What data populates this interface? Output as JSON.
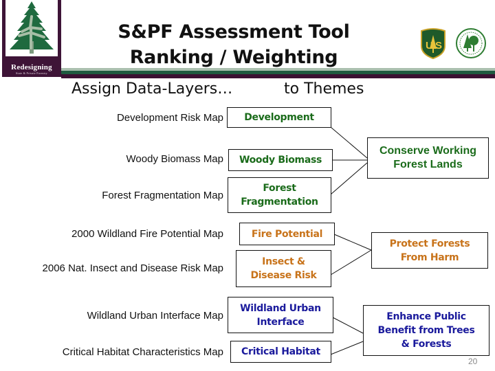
{
  "header": {
    "logo": {
      "icon": "evergreen-tree-icon",
      "title": "Redesigning",
      "subtitle": "State & Private Forestry"
    },
    "title_line1": "S&PF Assessment Tool",
    "title_line2": "Ranking / Weighting",
    "agency_logos": [
      "usda-forest-service-shield-icon",
      "state-foresters-seal-icon"
    ]
  },
  "subtitle": {
    "left": "Assign Data-Layers…",
    "right": "to Themes"
  },
  "map_labels": [
    "Development Risk Map",
    "Woody Biomass Map",
    "Forest Fragmentation Map",
    "2000 Wildland Fire Potential Map",
    "2006 Nat. Insect and Disease Risk Map",
    "Wildland Urban Interface Map",
    "Critical Habitat Characteristics Map"
  ],
  "data_layers": [
    {
      "line1": "Development",
      "line2": "",
      "theme": 0
    },
    {
      "line1": "Woody Biomass",
      "line2": "",
      "theme": 0
    },
    {
      "line1": "Forest",
      "line2": "Fragmentation",
      "theme": 0
    },
    {
      "line1": "Fire Potential",
      "line2": "",
      "theme": 1
    },
    {
      "line1": "Insect &",
      "line2": "Disease Risk",
      "theme": 1
    },
    {
      "line1": "Wildland Urban",
      "line2": "Interface",
      "theme": 2
    },
    {
      "line1": "Critical Habitat",
      "line2": "",
      "theme": 2
    }
  ],
  "themes": [
    {
      "line1": "Conserve Working",
      "line2": "Forest Lands",
      "line3": "",
      "color": "#1a6b1a"
    },
    {
      "line1": "Protect Forests",
      "line2": "From Harm",
      "line3": "",
      "color": "#c8731a"
    },
    {
      "line1": "Enhance Public",
      "line2": "Benefit from Trees",
      "line3": "& Forests",
      "color": "#1a1a9c"
    }
  ],
  "colors": {
    "green": "#1a6b1a",
    "orange": "#c8731a",
    "blue": "#1a1a9c",
    "brand_purple": "#3b1032",
    "brand_green": "#1f5a40"
  },
  "footer": {
    "page_number": "20"
  }
}
